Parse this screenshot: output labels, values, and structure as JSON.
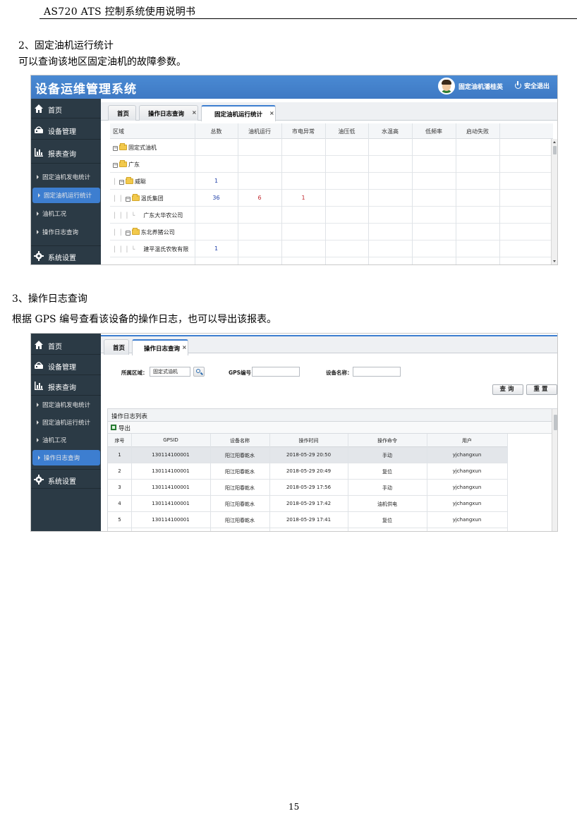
{
  "doc": {
    "header": "AS720    ATS 控制系统使用说明书",
    "section2_heading": "2、固定油机运行统计",
    "section2_text": "可以查询该地区固定油机的故障参数。",
    "section3_heading": "3、操作日志查询",
    "section3_text": "根据 GPS 编号查看该设备的操作日志，也可以导出该报表。",
    "page_number": "15"
  },
  "app": {
    "system_title": "设备运维管理系统",
    "user_name": "固定油机潘桂英",
    "logout_label": "安全退出"
  },
  "sidebar": {
    "home": "首页",
    "device_mgmt": "设备管理",
    "report_query": "报表查询",
    "sub_items": [
      "固定油机发电统计",
      "固定油机运行统计",
      "油机工况",
      "操作日志查询"
    ],
    "system_settings": "系统设置"
  },
  "shot1": {
    "tabs": [
      "首页",
      "操作日志查询",
      "固定油机运行统计"
    ],
    "columns": [
      "区域",
      "总数",
      "油机运行",
      "市电异常",
      "油压低",
      "水温高",
      "低频率",
      "启动失败"
    ],
    "rows": [
      {
        "name": "固定式油机",
        "values": [
          "",
          "",
          "",
          "",
          "",
          "",
          ""
        ]
      },
      {
        "name": "广东",
        "values": [
          "",
          "",
          "",
          "",
          "",
          "",
          ""
        ]
      },
      {
        "name": "威聪",
        "values": [
          "1",
          "",
          "",
          "",
          "",
          "",
          ""
        ]
      },
      {
        "name": "温氏集团",
        "values": [
          "36",
          "6",
          "1",
          "",
          "",
          "",
          ""
        ]
      },
      {
        "name": "广东大华农公司",
        "values": [
          "",
          "",
          "",
          "",
          "",
          "",
          ""
        ]
      },
      {
        "name": "东北养猪公司",
        "values": [
          "",
          "",
          "",
          "",
          "",
          "",
          ""
        ]
      },
      {
        "name": "建平温氏农牧有限",
        "values": [
          "1",
          "",
          "",
          "",
          "",
          "",
          ""
        ]
      }
    ]
  },
  "shot2": {
    "tabs": [
      "首页",
      "操作日志查询"
    ],
    "filter": {
      "region_label": "所属区域：",
      "region_value": "固定式油机",
      "gps_label": "GPS编号：",
      "gps_value": "",
      "device_label": "设备名称：",
      "device_value": "",
      "query_button": "查询",
      "reset_button": "重置"
    },
    "list_title": "操作日志列表",
    "export_label": "导出",
    "columns": [
      "序号",
      "GPSID",
      "设备名称",
      "操作时间",
      "操作命令",
      "用户"
    ],
    "rows": [
      [
        "1",
        "130114100001",
        "阳江阳春乾水",
        "2018-05-29 20:50",
        "手动",
        "yjchangxun"
      ],
      [
        "2",
        "130114100001",
        "阳江阳春乾水",
        "2018-05-29 20:49",
        "复位",
        "yjchangxun"
      ],
      [
        "3",
        "130114100001",
        "阳江阳春乾水",
        "2018-05-29 17:56",
        "手动",
        "yjchangxun"
      ],
      [
        "4",
        "130114100001",
        "阳江阳春乾水",
        "2018-05-29 17:42",
        "油机供电",
        "yjchangxun"
      ],
      [
        "5",
        "130114100001",
        "阳江阳春乾水",
        "2018-05-29 17:41",
        "复位",
        "yjchangxun"
      ]
    ]
  },
  "icons": {
    "home": "home-icon",
    "device": "device-icon",
    "report": "bar-chart-icon",
    "settings": "gear-icon",
    "folder": "folder-icon",
    "excel": "excel-icon",
    "search": "search-icon",
    "power": "power-icon"
  },
  "colors": {
    "topbar": "#3e79c4",
    "sidebar": "#2b3a45",
    "active_item": "#3d7ed0",
    "link_number": "#1f3fa8",
    "alert_number": "#c0262c"
  }
}
